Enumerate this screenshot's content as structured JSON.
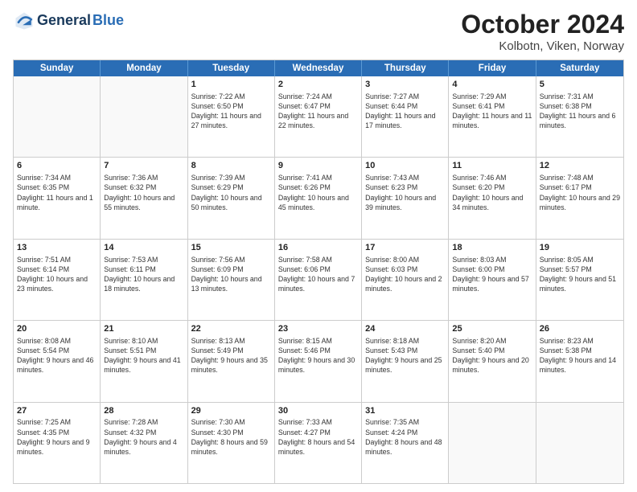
{
  "header": {
    "logo_line1": "General",
    "logo_line2": "Blue",
    "title": "October 2024",
    "subtitle": "Kolbotn, Viken, Norway"
  },
  "calendar": {
    "weekdays": [
      "Sunday",
      "Monday",
      "Tuesday",
      "Wednesday",
      "Thursday",
      "Friday",
      "Saturday"
    ],
    "rows": [
      [
        {
          "day": "",
          "text": ""
        },
        {
          "day": "",
          "text": ""
        },
        {
          "day": "1",
          "text": "Sunrise: 7:22 AM\nSunset: 6:50 PM\nDaylight: 11 hours and 27 minutes."
        },
        {
          "day": "2",
          "text": "Sunrise: 7:24 AM\nSunset: 6:47 PM\nDaylight: 11 hours and 22 minutes."
        },
        {
          "day": "3",
          "text": "Sunrise: 7:27 AM\nSunset: 6:44 PM\nDaylight: 11 hours and 17 minutes."
        },
        {
          "day": "4",
          "text": "Sunrise: 7:29 AM\nSunset: 6:41 PM\nDaylight: 11 hours and 11 minutes."
        },
        {
          "day": "5",
          "text": "Sunrise: 7:31 AM\nSunset: 6:38 PM\nDaylight: 11 hours and 6 minutes."
        }
      ],
      [
        {
          "day": "6",
          "text": "Sunrise: 7:34 AM\nSunset: 6:35 PM\nDaylight: 11 hours and 1 minute."
        },
        {
          "day": "7",
          "text": "Sunrise: 7:36 AM\nSunset: 6:32 PM\nDaylight: 10 hours and 55 minutes."
        },
        {
          "day": "8",
          "text": "Sunrise: 7:39 AM\nSunset: 6:29 PM\nDaylight: 10 hours and 50 minutes."
        },
        {
          "day": "9",
          "text": "Sunrise: 7:41 AM\nSunset: 6:26 PM\nDaylight: 10 hours and 45 minutes."
        },
        {
          "day": "10",
          "text": "Sunrise: 7:43 AM\nSunset: 6:23 PM\nDaylight: 10 hours and 39 minutes."
        },
        {
          "day": "11",
          "text": "Sunrise: 7:46 AM\nSunset: 6:20 PM\nDaylight: 10 hours and 34 minutes."
        },
        {
          "day": "12",
          "text": "Sunrise: 7:48 AM\nSunset: 6:17 PM\nDaylight: 10 hours and 29 minutes."
        }
      ],
      [
        {
          "day": "13",
          "text": "Sunrise: 7:51 AM\nSunset: 6:14 PM\nDaylight: 10 hours and 23 minutes."
        },
        {
          "day": "14",
          "text": "Sunrise: 7:53 AM\nSunset: 6:11 PM\nDaylight: 10 hours and 18 minutes."
        },
        {
          "day": "15",
          "text": "Sunrise: 7:56 AM\nSunset: 6:09 PM\nDaylight: 10 hours and 13 minutes."
        },
        {
          "day": "16",
          "text": "Sunrise: 7:58 AM\nSunset: 6:06 PM\nDaylight: 10 hours and 7 minutes."
        },
        {
          "day": "17",
          "text": "Sunrise: 8:00 AM\nSunset: 6:03 PM\nDaylight: 10 hours and 2 minutes."
        },
        {
          "day": "18",
          "text": "Sunrise: 8:03 AM\nSunset: 6:00 PM\nDaylight: 9 hours and 57 minutes."
        },
        {
          "day": "19",
          "text": "Sunrise: 8:05 AM\nSunset: 5:57 PM\nDaylight: 9 hours and 51 minutes."
        }
      ],
      [
        {
          "day": "20",
          "text": "Sunrise: 8:08 AM\nSunset: 5:54 PM\nDaylight: 9 hours and 46 minutes."
        },
        {
          "day": "21",
          "text": "Sunrise: 8:10 AM\nSunset: 5:51 PM\nDaylight: 9 hours and 41 minutes."
        },
        {
          "day": "22",
          "text": "Sunrise: 8:13 AM\nSunset: 5:49 PM\nDaylight: 9 hours and 35 minutes."
        },
        {
          "day": "23",
          "text": "Sunrise: 8:15 AM\nSunset: 5:46 PM\nDaylight: 9 hours and 30 minutes."
        },
        {
          "day": "24",
          "text": "Sunrise: 8:18 AM\nSunset: 5:43 PM\nDaylight: 9 hours and 25 minutes."
        },
        {
          "day": "25",
          "text": "Sunrise: 8:20 AM\nSunset: 5:40 PM\nDaylight: 9 hours and 20 minutes."
        },
        {
          "day": "26",
          "text": "Sunrise: 8:23 AM\nSunset: 5:38 PM\nDaylight: 9 hours and 14 minutes."
        }
      ],
      [
        {
          "day": "27",
          "text": "Sunrise: 7:25 AM\nSunset: 4:35 PM\nDaylight: 9 hours and 9 minutes."
        },
        {
          "day": "28",
          "text": "Sunrise: 7:28 AM\nSunset: 4:32 PM\nDaylight: 9 hours and 4 minutes."
        },
        {
          "day": "29",
          "text": "Sunrise: 7:30 AM\nSunset: 4:30 PM\nDaylight: 8 hours and 59 minutes."
        },
        {
          "day": "30",
          "text": "Sunrise: 7:33 AM\nSunset: 4:27 PM\nDaylight: 8 hours and 54 minutes."
        },
        {
          "day": "31",
          "text": "Sunrise: 7:35 AM\nSunset: 4:24 PM\nDaylight: 8 hours and 48 minutes."
        },
        {
          "day": "",
          "text": ""
        },
        {
          "day": "",
          "text": ""
        }
      ]
    ]
  }
}
